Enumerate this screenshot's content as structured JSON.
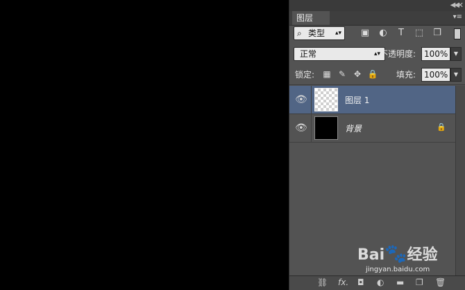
{
  "panel": {
    "tab_label": "图层",
    "filter_label": "类型",
    "blend_mode": "正常",
    "opacity_label": "不透明度:",
    "opacity_value": "100%",
    "lock_label": "锁定:",
    "fill_label": "填充:",
    "fill_value": "100%",
    "icons": {
      "filter_search": "search-icon",
      "filter_types": [
        "image-icon",
        "adjustment-icon",
        "text-icon",
        "shape-icon",
        "smart-object-icon"
      ],
      "locks": [
        "lock-transparent-icon",
        "lock-paint-icon",
        "lock-move-icon",
        "lock-all-icon"
      ],
      "bottom": [
        "link-icon",
        "fx-icon",
        "mask-icon",
        "adjustment-layer-icon",
        "folder-icon",
        "new-layer-icon",
        "trash-icon"
      ]
    }
  },
  "layers": [
    {
      "name": "图层 1",
      "selected": true,
      "thumbnail": "transparent"
    },
    {
      "name": "背景",
      "selected": false,
      "thumbnail": "black",
      "locked": true
    }
  ],
  "bottom_icons": {
    "fx": "fx."
  },
  "watermark": {
    "logo_text": "Bai",
    "logo_text2": "经验",
    "url": "jingyan.baidu.com"
  },
  "colors": {
    "panel_bg": "#535353",
    "selected_layer": "#516585",
    "canvas": "#000000"
  }
}
